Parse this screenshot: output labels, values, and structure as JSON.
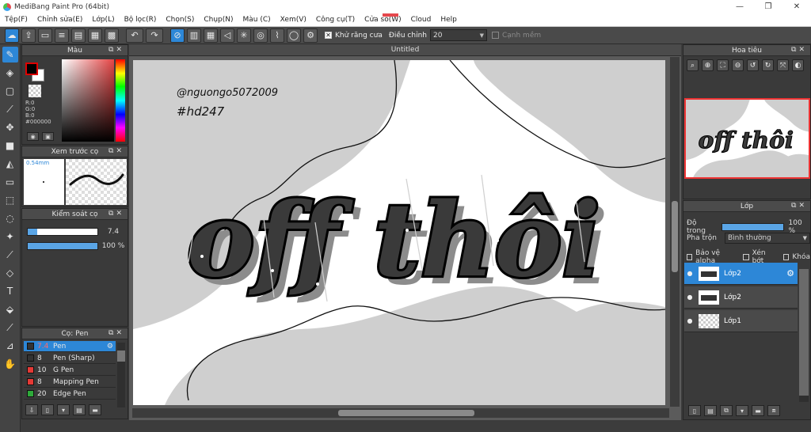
{
  "window": {
    "title": "MediBang Paint Pro (64bit)"
  },
  "menu": [
    "Tệp(F)",
    "Chỉnh sửa(E)",
    "Lớp(L)",
    "Bộ lọc(R)",
    "Chọn(S)",
    "Chụp(N)",
    "Màu (C)",
    "Xem(V)",
    "Công cụ(T)",
    "Cửa sổ(W)",
    "Cloud",
    "Help"
  ],
  "toolbar": {
    "antialias_label": "Khử răng cưa",
    "antialias_checked": "✕",
    "adjust_label": "Điều chỉnh",
    "adjust_value": "20",
    "smooth_label": "Cạnh mềm"
  },
  "panels": {
    "color": {
      "title": "Màu",
      "rgb": [
        "R:0",
        "G:0",
        "B:0",
        "#000000"
      ]
    },
    "preview": {
      "title": "Xem trước cọ",
      "size": "0.54mm"
    },
    "brush_control": {
      "title": "Kiểm soát cọ",
      "size_value": "7.4",
      "size_fraction": 0.14,
      "opacity_value": "100 %",
      "opacity_fraction": 1.0
    },
    "brush": {
      "title": "Cọ: Pen",
      "items": [
        {
          "size": "7.4",
          "name": "Pen",
          "color": "#333333"
        },
        {
          "size": "8",
          "name": "Pen (Sharp)",
          "color": "#333333"
        },
        {
          "size": "10",
          "name": "G Pen",
          "color": "#e53935"
        },
        {
          "size": "8",
          "name": "Mapping Pen",
          "color": "#e53935"
        },
        {
          "size": "20",
          "name": "Edge Pen",
          "color": "#2eaa3a"
        }
      ]
    },
    "navigator": {
      "title": "Hoa tiêu"
    },
    "layer": {
      "title": "Lớp",
      "opacity_label": "Độ trong",
      "opacity_value": "100 %",
      "opacity_fraction": 1.0,
      "blend_label": "Pha trộn",
      "blend_value": "Bình thường",
      "protect_alpha": "Bảo vệ alpha",
      "clipping": "Xén bớt",
      "lock": "Khóa",
      "layers": [
        {
          "name": "Lớp2"
        },
        {
          "name": "Lớp2"
        },
        {
          "name": "Lớp1"
        }
      ]
    }
  },
  "document": {
    "tab": "Untitled",
    "signature_line1": "@nguongo5072009",
    "signature_line2": "#hd247",
    "artwork_text": "off thôi"
  }
}
